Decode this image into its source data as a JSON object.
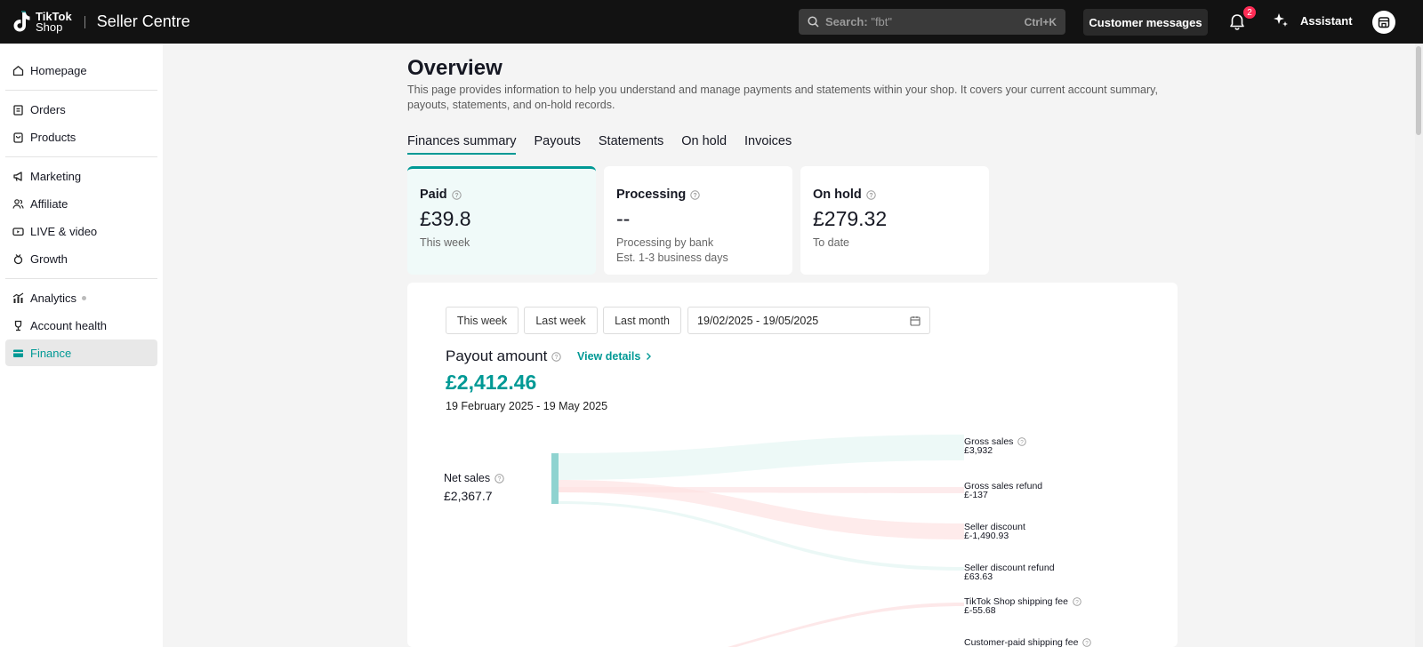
{
  "header": {
    "brand_line1": "TikTok",
    "brand_line2": "Shop",
    "app_title": "Seller Centre",
    "search_label": "Search:",
    "search_placeholder": "\"fbt\"",
    "search_shortcut": "Ctrl+K",
    "customer_messages": "Customer messages",
    "notifications_count": "2",
    "assistant_label": "Assistant"
  },
  "sidebar": {
    "items": [
      {
        "label": "Homepage",
        "icon": "home-icon"
      },
      {
        "label": "Orders",
        "icon": "clipboard-icon"
      },
      {
        "label": "Products",
        "icon": "bag-icon"
      },
      {
        "label": "Marketing",
        "icon": "megaphone-icon"
      },
      {
        "label": "Affiliate",
        "icon": "users-icon"
      },
      {
        "label": "LIVE & video",
        "icon": "video-icon"
      },
      {
        "label": "Growth",
        "icon": "medal-icon"
      },
      {
        "label": "Analytics",
        "icon": "analytics-icon"
      },
      {
        "label": "Account health",
        "icon": "trophy-icon"
      },
      {
        "label": "Finance",
        "icon": "wallet-icon"
      }
    ]
  },
  "main": {
    "title": "Overview",
    "description": "This page provides information to help you understand and manage payments and statements within your shop. It covers your current account summary, payouts, statements, and on-hold records.",
    "tabs": [
      {
        "label": "Finances summary"
      },
      {
        "label": "Payouts"
      },
      {
        "label": "Statements"
      },
      {
        "label": "On hold"
      },
      {
        "label": "Invoices"
      }
    ],
    "cards": [
      {
        "title": "Paid",
        "value": "£39.8",
        "sub1": "This week",
        "sub2": ""
      },
      {
        "title": "Processing",
        "value": "--",
        "sub1": "Processing by bank",
        "sub2": "Est. 1-3 business days"
      },
      {
        "title": "On hold",
        "value": "£279.32",
        "sub1": "To date",
        "sub2": ""
      }
    ],
    "filters": {
      "this_week": "This week",
      "last_week": "Last week",
      "last_month": "Last month",
      "date_range": "19/02/2025 - 19/05/2025"
    },
    "payout": {
      "title": "Payout amount",
      "view_details": "View details",
      "amount": "£2,412.46",
      "period": "19 February 2025 - 19 May 2025"
    },
    "sankey": {
      "source_label": "Net sales",
      "source_value": "£2,367.7",
      "flows": [
        {
          "label": "Gross sales",
          "value": "£3,932"
        },
        {
          "label": "Gross sales refund",
          "value": "£-137"
        },
        {
          "label": "Seller discount",
          "value": "£-1,490.93"
        },
        {
          "label": "Seller discount refund",
          "value": "£63.63"
        },
        {
          "label": "TikTok Shop shipping fee",
          "value": "£-55.68"
        },
        {
          "label": "Customer-paid shipping fee",
          "value": ""
        }
      ]
    }
  },
  "colors": {
    "accent": "#009995",
    "topbar": "#121212",
    "badge": "#fe2c55"
  }
}
